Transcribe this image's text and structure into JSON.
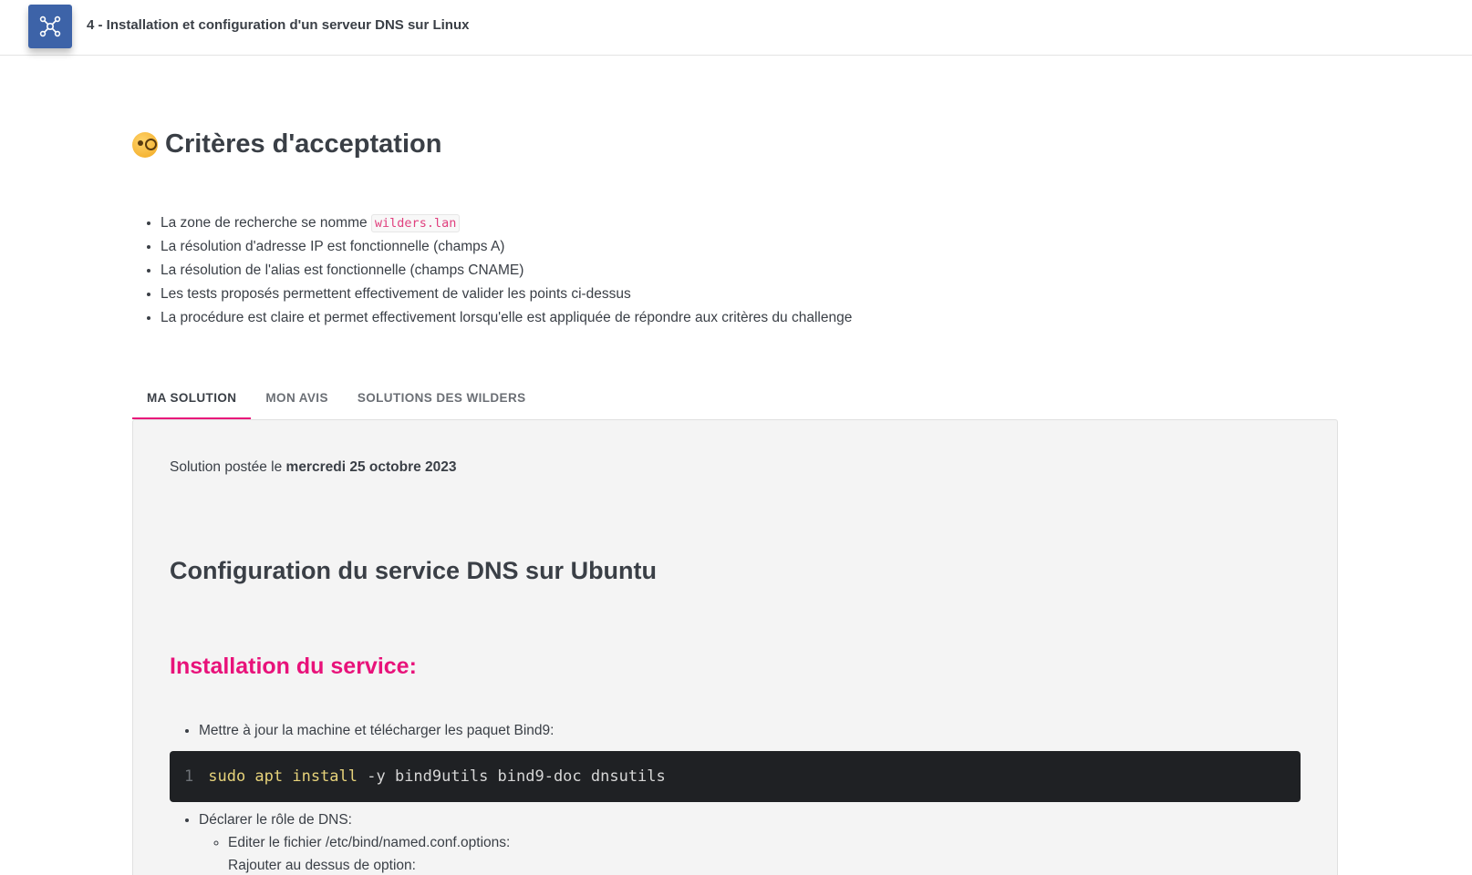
{
  "header": {
    "title": "4 - Installation et configuration d'un serveur DNS sur Linux",
    "logo_icon": "network-icon",
    "accent_color": "#3d63a8"
  },
  "criteria": {
    "heading": "Critères d'acceptation",
    "heading_icon": "thinking-face-monocle-icon",
    "items": [
      {
        "text": "La zone de recherche se nomme ",
        "code": "wilders.lan"
      },
      {
        "text": "La résolution d'adresse IP est fonctionnelle (champs A)"
      },
      {
        "text": "La résolution de l'alias est fonctionnelle (champs CNAME)"
      },
      {
        "text": "Les tests proposés permettent effectivement de valider les points ci-dessus"
      },
      {
        "text": "La procédure est claire et permet effectivement lorsqu'elle est appliquée de répondre aux critères du challenge"
      }
    ]
  },
  "tabs": [
    {
      "label": "MA SOLUTION",
      "active": true
    },
    {
      "label": "MON AVIS",
      "active": false
    },
    {
      "label": "SOLUTIONS DES WILDERS",
      "active": false
    }
  ],
  "tab_accent_color": "#e8127a",
  "solution": {
    "posted_prefix": "Solution postée le ",
    "posted_date": "mercredi 25 octobre 2023",
    "h2": "Configuration du service DNS sur Ubuntu",
    "h3": "Installation du service:",
    "step1": "Mettre à jour la machine et télécharger les paquet Bind9:",
    "code": {
      "line_number": "1",
      "keywords": "sudo apt install",
      "rest": " -y bind9utils bind9-doc dnsutils"
    },
    "step2": "Déclarer le rôle de DNS:",
    "step2_sub": [
      "Editer le fichier /etc/bind/named.conf.options:",
      "Rajouter au dessus de option:"
    ]
  }
}
